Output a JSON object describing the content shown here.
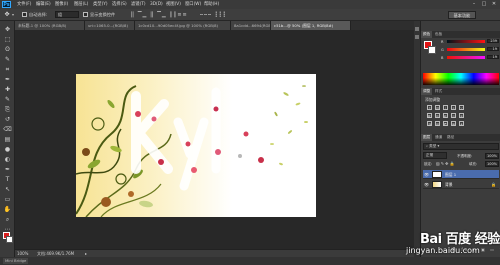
{
  "app": {
    "logo": "Ps"
  },
  "menubar": {
    "items": [
      "文件(F)",
      "编辑(E)",
      "图像(I)",
      "图层(L)",
      "类型(Y)",
      "选择(S)",
      "滤镜(T)",
      "3D(D)",
      "视图(V)",
      "窗口(W)",
      "帮助(H)"
    ],
    "minimize": "–",
    "maximize": "□",
    "close": "✕"
  },
  "optionsbar": {
    "auto_select_label": "自动选择:",
    "auto_select_value": "组",
    "show_transform_label": "显示变换控件",
    "workspace_label": "基本功能"
  },
  "tabs": [
    {
      "label": "未标题-1 @ 100% (RGB/8)",
      "active": false
    },
    {
      "label": "uri=1065.0...(RGB/8)",
      "active": false
    },
    {
      "label": "1c0cd10...90d05ec4f.jpg @ 100% (RGB/8)",
      "active": false
    },
    {
      "label": "8a1cdd...6694(RGB/8)",
      "active": false
    },
    {
      "label": "c51b...@ 50% (图层 1, RGB/8#)",
      "active": true
    }
  ],
  "toolbar": {
    "tools": [
      "move-tool",
      "marquee-tool",
      "lasso-tool",
      "quick-select-tool",
      "crop-tool",
      "eyedropper-tool",
      "healing-tool",
      "brush-tool",
      "clone-stamp-tool",
      "history-brush-tool",
      "eraser-tool",
      "gradient-tool",
      "blur-tool",
      "dodge-tool",
      "pen-tool",
      "type-tool",
      "path-select-tool",
      "rectangle-tool",
      "hand-tool",
      "zoom-tool",
      "extra-tool"
    ],
    "glyphs": [
      "✥",
      "⬚",
      "ʘ",
      "✎",
      "⌗",
      "✒",
      "✚",
      "✎",
      "⎘",
      "↺",
      "⌫",
      "▤",
      "●",
      "◐",
      "✒",
      "T",
      "↖",
      "▭",
      "✋",
      "⌕",
      "⋯"
    ],
    "fg_color": "#d81e1e",
    "bg_color": "#ffffff"
  },
  "canvas": {
    "artwork_text": "kyle"
  },
  "statusbar": {
    "zoom": "100%",
    "doc_info": "文档:469.9K/1.76M",
    "mini_bridge": "Mini Bridge"
  },
  "panels": {
    "color_tabs": [
      "颜色",
      "色板"
    ],
    "sliders": [
      {
        "label": "R",
        "value": "239"
      },
      {
        "label": "G",
        "value": "19"
      },
      {
        "label": "B",
        "value": "19"
      }
    ],
    "adjust_tabs": [
      "调整",
      "样式"
    ],
    "adjust_title": "添加调整",
    "layers_tabs": [
      "图层",
      "通道",
      "路径"
    ],
    "blend_mode": "正常",
    "opacity_label": "不透明度:",
    "opacity_value": "100%",
    "lock_label": "锁定:",
    "fill_label": "填充:",
    "fill_value": "100%",
    "layers": [
      {
        "name": "图层 1",
        "active": true
      },
      {
        "name": "背景",
        "active": false
      }
    ]
  },
  "watermark": {
    "logo": "Bai 百度 经验",
    "url": "jingyan.baidu.com"
  }
}
